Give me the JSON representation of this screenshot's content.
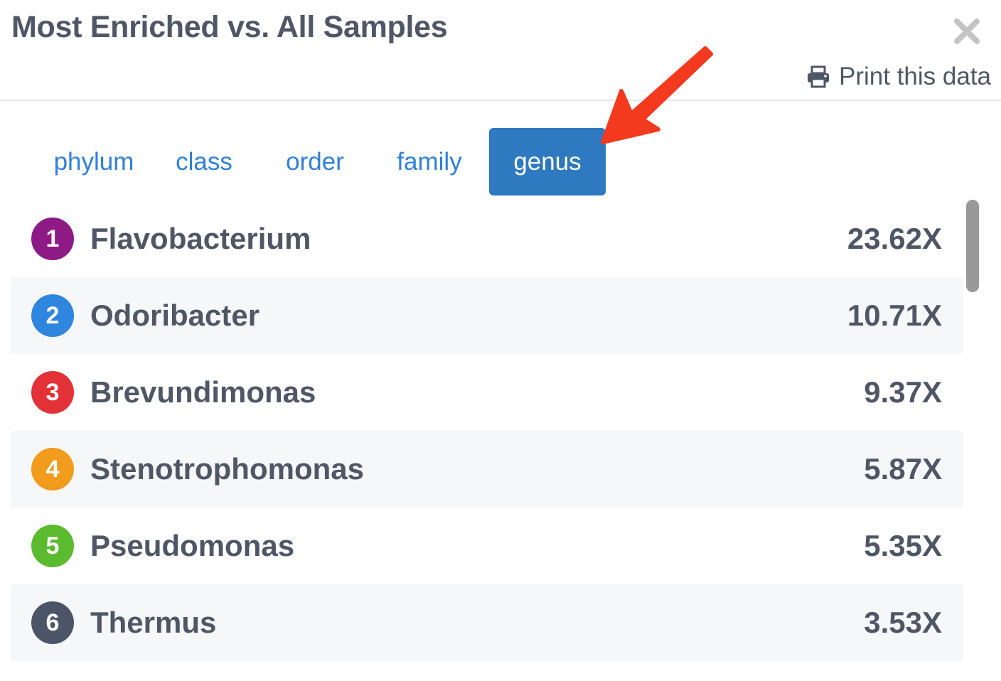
{
  "header": {
    "title": "Most Enriched vs. All Samples",
    "print_label": "Print this data",
    "close_icon": "close-icon",
    "print_icon": "printer-icon"
  },
  "tabs": [
    {
      "label": "phylum",
      "active": false
    },
    {
      "label": "class",
      "active": false
    },
    {
      "label": "order",
      "active": false
    },
    {
      "label": "family",
      "active": false
    },
    {
      "label": "genus",
      "active": true
    }
  ],
  "items": [
    {
      "rank": "1",
      "name": "Flavobacterium",
      "value": "23.62X",
      "color": "#8e1a86"
    },
    {
      "rank": "2",
      "name": "Odoribacter",
      "value": "10.71X",
      "color": "#2f86de"
    },
    {
      "rank": "3",
      "name": "Brevundimonas",
      "value": "9.37X",
      "color": "#e33237"
    },
    {
      "rank": "4",
      "name": "Stenotrophomonas",
      "value": "5.87X",
      "color": "#f19c1c"
    },
    {
      "rank": "5",
      "name": "Pseudomonas",
      "value": "5.35X",
      "color": "#5cba2f"
    },
    {
      "rank": "6",
      "name": "Thermus",
      "value": "3.53X",
      "color": "#4c5568"
    }
  ],
  "colors": {
    "accent": "#2e79bf",
    "tab_link": "#2f80d8",
    "text": "#4f5665",
    "annotation_arrow": "#f33a1e"
  }
}
